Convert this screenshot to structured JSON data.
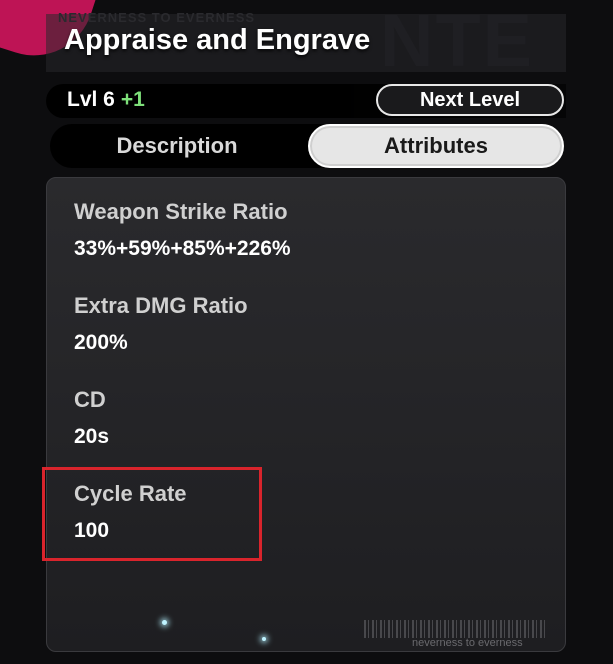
{
  "background": {
    "banner_text": "NEVERNESS TO EVERNESS",
    "watermark": "NTE",
    "accent_color": "#c8155a"
  },
  "skill": {
    "title": "Appraise and Engrave",
    "level_label": "Lvl 6",
    "level_increment": "+1",
    "next_level_label": "Next Level"
  },
  "tabs": [
    {
      "label": "Description",
      "active": false
    },
    {
      "label": "Attributes",
      "active": true
    }
  ],
  "attributes": [
    {
      "name": "Weapon Strike Ratio",
      "value": "33%+59%+85%+226%"
    },
    {
      "name": "Extra DMG Ratio",
      "value": "200%"
    },
    {
      "name": "CD",
      "value": "20s"
    },
    {
      "name": "Cycle Rate",
      "value": "100",
      "highlighted": true
    }
  ],
  "footer": {
    "text": "neverness to everness"
  },
  "colors": {
    "level_increment": "#7ee07a",
    "highlight": "#d9242c",
    "active_tab_bg": "#e6e6e6"
  }
}
